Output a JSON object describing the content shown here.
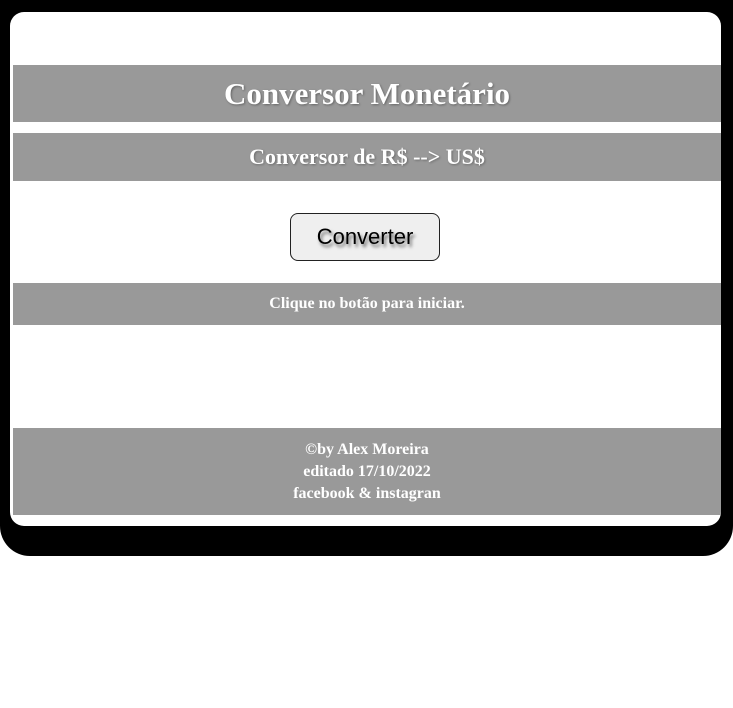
{
  "header": {
    "title": "Conversor Monetário",
    "subtitle": "Conversor de R$ --> US$"
  },
  "main": {
    "convert_button_label": "Converter",
    "status_text": "Clique no botão para iniciar."
  },
  "footer": {
    "credit": "©by Alex Moreira",
    "edited": "editado 17/10/2022",
    "social": "facebook & instagran"
  },
  "colors": {
    "band": "#999999",
    "frame": "#000000",
    "text": "#ffffff"
  }
}
